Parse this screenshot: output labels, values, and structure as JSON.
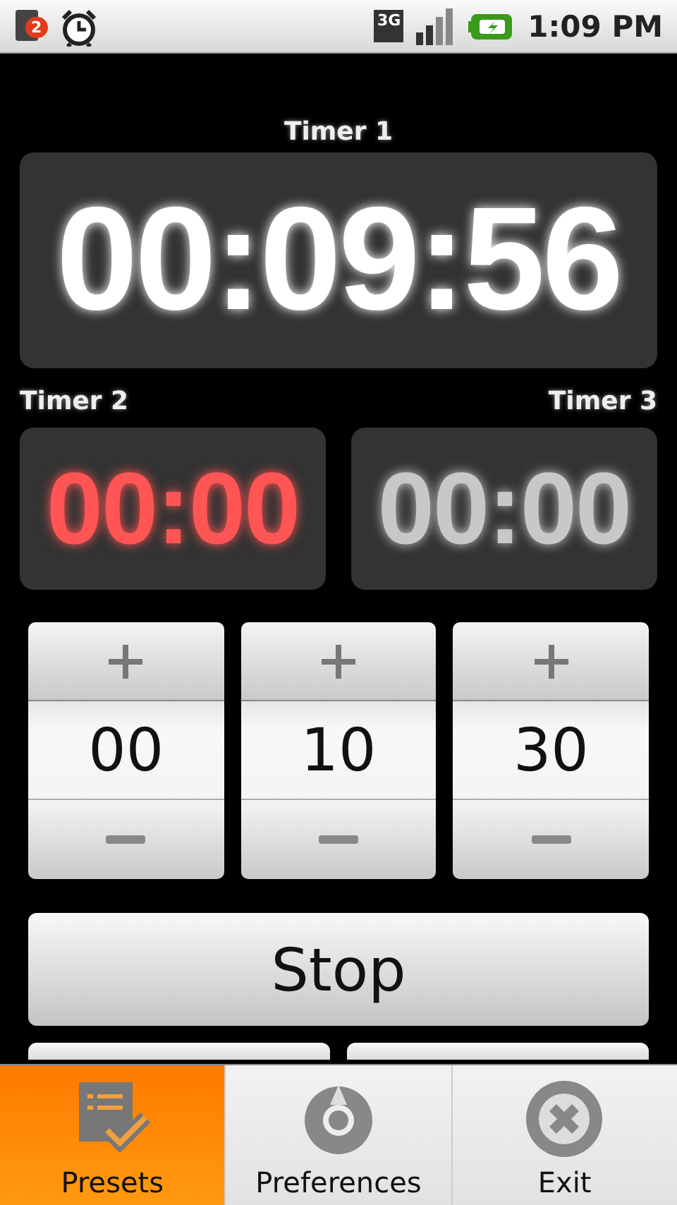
{
  "status_bar": {
    "notification_count": "2",
    "network_type": "3G",
    "time": "1:09 PM"
  },
  "timers": [
    {
      "label": "Timer 1",
      "time": "00:09:56",
      "kind": "large",
      "color": "#ffffff"
    },
    {
      "label": "Timer 2",
      "time": "00:00",
      "kind": "small",
      "color": "#ff5555"
    },
    {
      "label": "Timer 3",
      "time": "00:00",
      "kind": "small",
      "color": "#c8c8c8"
    }
  ],
  "spinners": [
    {
      "value": "00"
    },
    {
      "value": "10"
    },
    {
      "value": "30"
    }
  ],
  "stop_button": {
    "label": "Stop"
  },
  "menu": [
    {
      "label": "Presets",
      "selected": true
    },
    {
      "label": "Preferences",
      "selected": false
    },
    {
      "label": "Exit",
      "selected": false
    }
  ]
}
